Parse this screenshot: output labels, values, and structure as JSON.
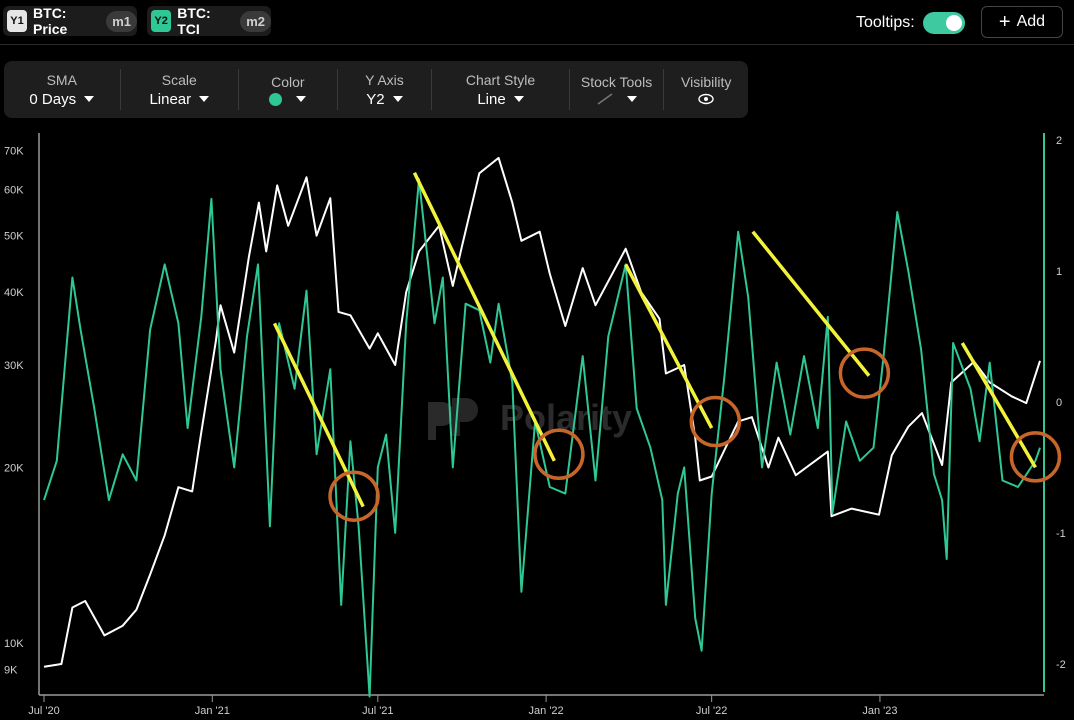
{
  "series_tabs": [
    {
      "badge": "Y1",
      "label": "BTC: Price",
      "tag": "m1"
    },
    {
      "badge": "Y2",
      "label": "BTC: TCI",
      "tag": "m2"
    }
  ],
  "tooltips_label": "Tooltips:",
  "add_label": "Add",
  "toolbar": {
    "sma": {
      "title": "SMA",
      "value": "0 Days"
    },
    "scale": {
      "title": "Scale",
      "value": "Linear"
    },
    "color": {
      "title": "Color",
      "value": "#2ec795"
    },
    "yaxis": {
      "title": "Y Axis",
      "value": "Y2"
    },
    "style": {
      "title": "Chart Style",
      "value": "Line"
    },
    "tools": {
      "title": "Stock Tools"
    },
    "visibility": {
      "title": "Visibility"
    }
  },
  "watermark": "Polarity",
  "chart_data": {
    "type": "line",
    "y1_scale": "log",
    "y1_ticks": [
      {
        "v": 70000,
        "label": "70K"
      },
      {
        "v": 60000,
        "label": "60K"
      },
      {
        "v": 50000,
        "label": "50K"
      },
      {
        "v": 40000,
        "label": "40K"
      },
      {
        "v": 30000,
        "label": "30K"
      },
      {
        "v": 20000,
        "label": "20K"
      },
      {
        "v": 10000,
        "label": "10K"
      },
      {
        "v": 9000,
        "label": "9K"
      }
    ],
    "y1_range": [
      8300,
      73000
    ],
    "y2_ticks": [
      2,
      1,
      0,
      -1,
      -2
    ],
    "y2_range": [
      -2.2,
      2.0
    ],
    "x_ticks": [
      {
        "date": "2020-07-01",
        "label": "Jul '20"
      },
      {
        "date": "2021-01-01",
        "label": "Jan '21"
      },
      {
        "date": "2021-07-01",
        "label": "Jul '21"
      },
      {
        "date": "2022-01-01",
        "label": "Jan '22"
      },
      {
        "date": "2022-07-01",
        "label": "Jul '22"
      },
      {
        "date": "2023-01-01",
        "label": "Jan '23"
      }
    ],
    "x_range": [
      "2020-07-01",
      "2023-06-25"
    ],
    "series": [
      {
        "color": "#ffffff",
        "axis": "y1",
        "points": [
          [
            "2020-07-01",
            9100
          ],
          [
            "2020-07-20",
            9200
          ],
          [
            "2020-08-01",
            11500
          ],
          [
            "2020-08-15",
            11800
          ],
          [
            "2020-09-05",
            10300
          ],
          [
            "2020-09-25",
            10700
          ],
          [
            "2020-10-10",
            11400
          ],
          [
            "2020-10-25",
            13100
          ],
          [
            "2020-11-10",
            15300
          ],
          [
            "2020-11-25",
            18500
          ],
          [
            "2020-12-10",
            18200
          ],
          [
            "2020-12-20",
            23000
          ],
          [
            "2021-01-05",
            33000
          ],
          [
            "2021-01-10",
            38000
          ],
          [
            "2021-01-25",
            31500
          ],
          [
            "2021-02-10",
            46000
          ],
          [
            "2021-02-21",
            57000
          ],
          [
            "2021-03-01",
            47000
          ],
          [
            "2021-03-13",
            61000
          ],
          [
            "2021-03-25",
            52000
          ],
          [
            "2021-04-14",
            63000
          ],
          [
            "2021-04-25",
            50000
          ],
          [
            "2021-05-10",
            58000
          ],
          [
            "2021-05-19",
            37000
          ],
          [
            "2021-06-01",
            36500
          ],
          [
            "2021-06-22",
            32000
          ],
          [
            "2021-07-01",
            34000
          ],
          [
            "2021-07-20",
            30000
          ],
          [
            "2021-08-01",
            40000
          ],
          [
            "2021-08-15",
            47000
          ],
          [
            "2021-09-06",
            52000
          ],
          [
            "2021-09-21",
            41000
          ],
          [
            "2021-10-01",
            48000
          ],
          [
            "2021-10-20",
            64000
          ],
          [
            "2021-11-10",
            68000
          ],
          [
            "2021-11-25",
            57000
          ],
          [
            "2021-12-05",
            49000
          ],
          [
            "2021-12-25",
            50800
          ],
          [
            "2022-01-05",
            43000
          ],
          [
            "2022-01-22",
            35000
          ],
          [
            "2022-02-10",
            44000
          ],
          [
            "2022-02-24",
            38000
          ],
          [
            "2022-03-29",
            47500
          ],
          [
            "2022-04-15",
            40000
          ],
          [
            "2022-05-05",
            36000
          ],
          [
            "2022-05-12",
            29000
          ],
          [
            "2022-06-01",
            30000
          ],
          [
            "2022-06-13",
            22500
          ],
          [
            "2022-06-18",
            19000
          ],
          [
            "2022-07-01",
            19300
          ],
          [
            "2022-07-30",
            24000
          ],
          [
            "2022-08-14",
            24400
          ],
          [
            "2022-09-01",
            20000
          ],
          [
            "2022-09-12",
            22500
          ],
          [
            "2022-10-01",
            19400
          ],
          [
            "2022-11-05",
            21300
          ],
          [
            "2022-11-09",
            16500
          ],
          [
            "2022-12-01",
            17000
          ],
          [
            "2022-12-31",
            16600
          ],
          [
            "2023-01-14",
            21000
          ],
          [
            "2023-02-01",
            23500
          ],
          [
            "2023-02-16",
            24800
          ],
          [
            "2023-03-10",
            20200
          ],
          [
            "2023-03-20",
            28000
          ],
          [
            "2023-04-14",
            30400
          ],
          [
            "2023-05-01",
            28000
          ],
          [
            "2023-05-25",
            26500
          ],
          [
            "2023-06-10",
            25800
          ],
          [
            "2023-06-25",
            30500
          ]
        ]
      },
      {
        "color": "#2ec795",
        "axis": "y2",
        "points": [
          [
            "2020-07-01",
            -0.75
          ],
          [
            "2020-07-15",
            -0.45
          ],
          [
            "2020-08-01",
            0.95
          ],
          [
            "2020-08-10",
            0.55
          ],
          [
            "2020-08-25",
            -0.05
          ],
          [
            "2020-09-10",
            -0.75
          ],
          [
            "2020-09-25",
            -0.4
          ],
          [
            "2020-10-10",
            -0.6
          ],
          [
            "2020-10-25",
            0.55
          ],
          [
            "2020-11-10",
            1.05
          ],
          [
            "2020-11-25",
            0.6
          ],
          [
            "2020-12-05",
            -0.2
          ],
          [
            "2020-12-20",
            0.65
          ],
          [
            "2020-12-31",
            1.55
          ],
          [
            "2021-01-10",
            0.25
          ],
          [
            "2021-01-25",
            -0.5
          ],
          [
            "2021-02-08",
            0.5
          ],
          [
            "2021-02-20",
            1.05
          ],
          [
            "2021-03-05",
            -0.95
          ],
          [
            "2021-03-15",
            0.6
          ],
          [
            "2021-04-01",
            0.1
          ],
          [
            "2021-04-14",
            0.85
          ],
          [
            "2021-04-25",
            -0.4
          ],
          [
            "2021-05-10",
            0.25
          ],
          [
            "2021-05-22",
            -1.55
          ],
          [
            "2021-06-01",
            -0.3
          ],
          [
            "2021-06-10",
            -0.95
          ],
          [
            "2021-06-22",
            -2.25
          ],
          [
            "2021-07-01",
            -0.5
          ],
          [
            "2021-07-10",
            -0.25
          ],
          [
            "2021-07-20",
            -1.0
          ],
          [
            "2021-08-01",
            0.6
          ],
          [
            "2021-08-15",
            1.7
          ],
          [
            "2021-09-01",
            0.6
          ],
          [
            "2021-09-10",
            0.95
          ],
          [
            "2021-09-21",
            -0.5
          ],
          [
            "2021-10-05",
            0.75
          ],
          [
            "2021-10-20",
            0.7
          ],
          [
            "2021-11-01",
            0.3
          ],
          [
            "2021-11-10",
            0.75
          ],
          [
            "2021-11-25",
            0.15
          ],
          [
            "2021-12-05",
            -1.45
          ],
          [
            "2021-12-20",
            -0.15
          ],
          [
            "2022-01-05",
            -0.65
          ],
          [
            "2022-01-22",
            -0.7
          ],
          [
            "2022-02-10",
            0.35
          ],
          [
            "2022-02-24",
            -0.6
          ],
          [
            "2022-03-10",
            0.5
          ],
          [
            "2022-03-29",
            1.05
          ],
          [
            "2022-04-10",
            -0.05
          ],
          [
            "2022-04-25",
            -0.35
          ],
          [
            "2022-05-08",
            -0.75
          ],
          [
            "2022-05-12",
            -1.55
          ],
          [
            "2022-05-25",
            -0.7
          ],
          [
            "2022-06-01",
            -0.5
          ],
          [
            "2022-06-13",
            -1.65
          ],
          [
            "2022-06-20",
            -1.9
          ],
          [
            "2022-07-01",
            -0.7
          ],
          [
            "2022-07-15",
            0.2
          ],
          [
            "2022-07-30",
            1.3
          ],
          [
            "2022-08-10",
            0.8
          ],
          [
            "2022-08-25",
            -0.5
          ],
          [
            "2022-09-10",
            0.3
          ],
          [
            "2022-09-25",
            -0.25
          ],
          [
            "2022-10-10",
            0.35
          ],
          [
            "2022-10-25",
            -0.2
          ],
          [
            "2022-11-05",
            0.65
          ],
          [
            "2022-11-10",
            -0.85
          ],
          [
            "2022-11-25",
            -0.15
          ],
          [
            "2022-12-10",
            -0.45
          ],
          [
            "2022-12-25",
            -0.35
          ],
          [
            "2023-01-05",
            0.35
          ],
          [
            "2023-01-20",
            1.45
          ],
          [
            "2023-02-01",
            1.0
          ],
          [
            "2023-02-15",
            0.4
          ],
          [
            "2023-03-01",
            -0.55
          ],
          [
            "2023-03-10",
            -0.75
          ],
          [
            "2023-03-15",
            -1.2
          ],
          [
            "2023-03-22",
            0.45
          ],
          [
            "2023-04-10",
            0.1
          ],
          [
            "2023-04-20",
            -0.3
          ],
          [
            "2023-05-01",
            0.3
          ],
          [
            "2023-05-15",
            -0.6
          ],
          [
            "2023-06-01",
            -0.65
          ],
          [
            "2023-06-20",
            -0.45
          ],
          [
            "2023-06-25",
            -0.35
          ]
        ]
      }
    ],
    "annotations": {
      "trend_lines": [
        {
          "from": [
            "2021-03-10",
            0.6
          ],
          "to": [
            "2021-06-15",
            -0.8
          ]
        },
        {
          "from": [
            "2021-08-10",
            1.75
          ],
          "to": [
            "2022-01-10",
            -0.45
          ]
        },
        {
          "from": [
            "2022-03-29",
            1.05
          ],
          "to": [
            "2022-07-01",
            -0.2
          ]
        },
        {
          "from": [
            "2022-08-15",
            1.3
          ],
          "to": [
            "2022-12-20",
            0.2
          ]
        },
        {
          "from": [
            "2023-04-01",
            0.45
          ],
          "to": [
            "2023-06-20",
            -0.5
          ]
        }
      ],
      "circles": [
        {
          "at": [
            "2021-06-05",
            -0.72
          ]
        },
        {
          "at": [
            "2022-01-15",
            -0.4
          ]
        },
        {
          "at": [
            "2022-07-05",
            -0.15
          ]
        },
        {
          "at": [
            "2022-12-15",
            0.22
          ]
        },
        {
          "at": [
            "2023-06-20",
            -0.42
          ]
        }
      ]
    }
  }
}
